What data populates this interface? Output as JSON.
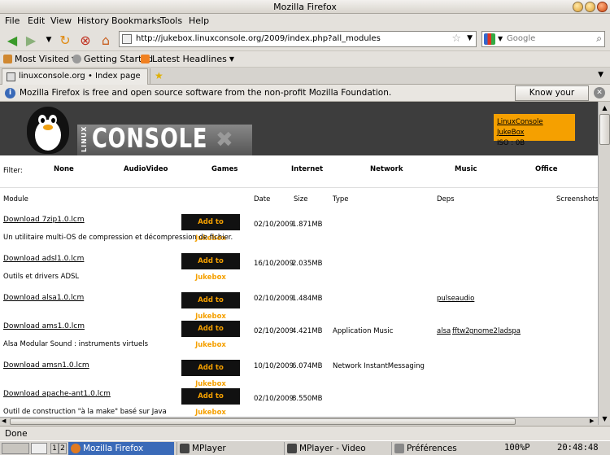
{
  "window": {
    "title": "Mozilla Firefox"
  },
  "menu": [
    "File",
    "Edit",
    "View",
    "History",
    "Bookmarks",
    "Tools",
    "Help"
  ],
  "nav": {
    "url": "http://jukebox.linuxconsole.org/2009/index.php?all_modules",
    "search_placeholder": "Google"
  },
  "bookmarks": [
    "Most Visited",
    "Getting Started",
    "Latest Headlines"
  ],
  "tabs": [
    {
      "label": "linuxconsole.org • Index page"
    }
  ],
  "notification": {
    "message": "Mozilla Firefox is free and open source software from the non-profit Mozilla Foundation.",
    "button": "Know your rights..."
  },
  "page": {
    "logo_small": "LINUX",
    "logo_big": "CONSOLE",
    "logo_mark": "✖",
    "jukebox_link": "LinuxConsole JukeBox",
    "iso": "ISO : 0B",
    "filter_label": "Filter:",
    "filters": [
      "None",
      "AudioVideo",
      "Games",
      "Internet",
      "Network",
      "Music",
      "Office"
    ],
    "columns": [
      "Module",
      "Date",
      "Size",
      "Type",
      "Deps",
      "Screenshots"
    ],
    "add_label": "Add to Jukebox",
    "modules": [
      {
        "link": "Download 7zip1.0.lcm",
        "date": "02/10/2009",
        "size": "1.871MB",
        "type": "",
        "deps": [],
        "desc": "Un utilitaire multi-OS de compression et décompression de fichier."
      },
      {
        "link": "Download adsl1.0.lcm",
        "date": "16/10/2009",
        "size": "2.035MB",
        "type": "",
        "deps": [],
        "desc": "Outils et drivers ADSL"
      },
      {
        "link": "Download alsa1.0.lcm",
        "date": "02/10/2009",
        "size": "1.484MB",
        "type": "",
        "deps": [
          "pulseaudio"
        ],
        "desc": ""
      },
      {
        "link": "Download ams1.0.lcm",
        "date": "02/10/2009",
        "size": "4.421MB",
        "type": "Application Music",
        "deps": [
          "alsa",
          "fftw2",
          "gnome2",
          "ladspa"
        ],
        "desc": "Alsa Modular Sound : instruments virtuels"
      },
      {
        "link": "Download amsn1.0.lcm",
        "date": "10/10/2009",
        "size": "6.074MB",
        "type": "Network InstantMessaging",
        "deps": [],
        "desc": ""
      },
      {
        "link": "Download apache-ant1.0.lcm",
        "date": "02/10/2009",
        "size": "8.550MB",
        "type": "",
        "deps": [],
        "desc": "Outil de construction \"à la make\" basé sur Java"
      }
    ]
  },
  "status": "Done",
  "taskbar": {
    "desktops": [
      "1",
      "2"
    ],
    "items": [
      "Mozilla Firefox",
      "MPlayer",
      "MPlayer - Video",
      "Préférences"
    ],
    "battery": "100%P",
    "clock": "20:48:48"
  },
  "colors": {
    "accent": "#f5a000",
    "header": "#3d3d3d",
    "selection": "#3a6ab8"
  }
}
